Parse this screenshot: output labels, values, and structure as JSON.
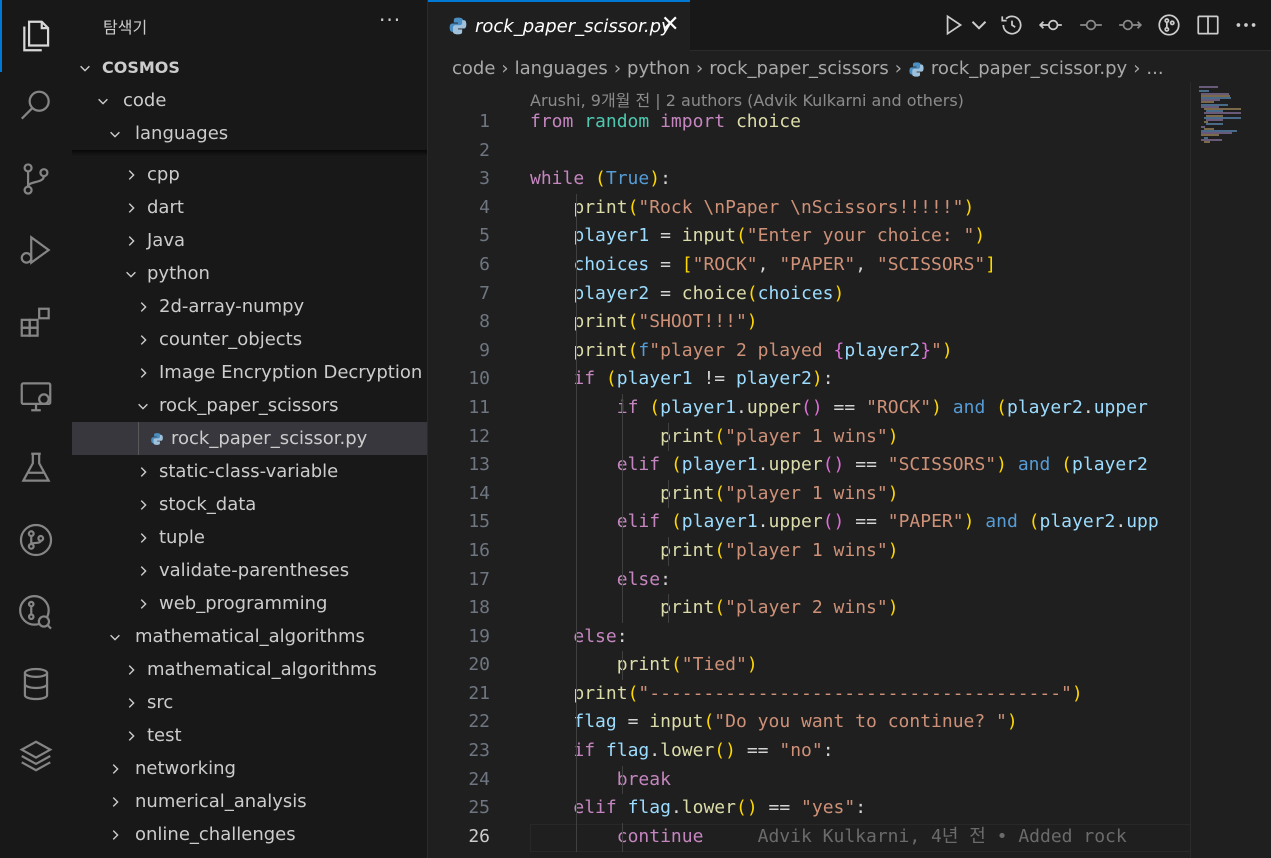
{
  "sidebar": {
    "title": "탐색기",
    "more": "···",
    "tree": [
      {
        "label": "COSMOS",
        "depth": 0,
        "expanded": true,
        "root": true
      },
      {
        "label": "code",
        "depth": 1,
        "expanded": true
      },
      {
        "label": "languages",
        "depth": 2,
        "expanded": true
      },
      {
        "label": "cpp",
        "depth": 3,
        "expanded": false
      },
      {
        "label": "dart",
        "depth": 3,
        "expanded": false
      },
      {
        "label": "Java",
        "depth": 3,
        "expanded": false
      },
      {
        "label": "python",
        "depth": 3,
        "expanded": true
      },
      {
        "label": "2d-array-numpy",
        "depth": 4,
        "expanded": false
      },
      {
        "label": "counter_objects",
        "depth": 4,
        "expanded": false
      },
      {
        "label": "Image Encryption Decryption",
        "depth": 4,
        "expanded": false
      },
      {
        "label": "rock_paper_scissors",
        "depth": 4,
        "expanded": true
      },
      {
        "label": "rock_paper_scissor.py",
        "depth": 5,
        "file": true,
        "selected": true
      },
      {
        "label": "static-class-variable",
        "depth": 4,
        "expanded": false
      },
      {
        "label": "stock_data",
        "depth": 4,
        "expanded": false
      },
      {
        "label": "tuple",
        "depth": 4,
        "expanded": false
      },
      {
        "label": "validate-parentheses",
        "depth": 4,
        "expanded": false
      },
      {
        "label": "web_programming",
        "depth": 4,
        "expanded": false
      },
      {
        "label": "mathematical_algorithms",
        "depth": 2,
        "expanded": true
      },
      {
        "label": "mathematical_algorithms",
        "depth": 3,
        "expanded": false
      },
      {
        "label": "src",
        "depth": 3,
        "expanded": false
      },
      {
        "label": "test",
        "depth": 3,
        "expanded": false
      },
      {
        "label": "networking",
        "depth": 2,
        "expanded": false
      },
      {
        "label": "numerical_analysis",
        "depth": 2,
        "expanded": false
      },
      {
        "label": "online_challenges",
        "depth": 2,
        "expanded": false
      }
    ]
  },
  "activity_icons": [
    "files-icon",
    "search-icon",
    "source-control-icon",
    "run-debug-icon",
    "extensions-icon",
    "remote-explorer-icon",
    "testing-icon",
    "git-graph-icon",
    "pull-requests-icon",
    "database-icon",
    "layers-icon"
  ],
  "editor": {
    "tab_label": "rock_paper_scissor.py",
    "close": "✕",
    "breadcrumb": [
      "code",
      "languages",
      "python",
      "rock_paper_scissors",
      "rock_paper_scissor.py",
      "..."
    ],
    "blame_header": "Arushi, 9개월 전 | 2 authors (Advik Kulkarni and others)",
    "inline_blame": "Advik Kulkarni, 4년 전 • Added rock",
    "current_line": 26,
    "line_numbers": [
      "1",
      "2",
      "3",
      "4",
      "5",
      "6",
      "7",
      "8",
      "9",
      "10",
      "11",
      "12",
      "13",
      "14",
      "15",
      "16",
      "17",
      "18",
      "19",
      "20",
      "21",
      "22",
      "23",
      "24",
      "25",
      "26"
    ],
    "lines": [
      "from random import choice",
      "",
      "while (True):",
      "    print(\"Rock \\nPaper \\nScissors!!!!!\")",
      "    player1 = input(\"Enter your choice: \")",
      "    choices = [\"ROCK\", \"PAPER\", \"SCISSORS\"]",
      "    player2 = choice(choices)",
      "    print(\"SHOOT!!!\")",
      "    print(f\"player 2 played {player2}\")",
      "    if (player1 != player2):",
      "        if (player1.upper() == \"ROCK\") and (player2.upper",
      "            print(\"player 1 wins\")",
      "        elif (player1.upper() == \"SCISSORS\") and (player2",
      "            print(\"player 1 wins\")",
      "        elif (player1.upper() == \"PAPER\") and (player2.upp",
      "            print(\"player 1 wins\")",
      "        else:",
      "            print(\"player 2 wins\")",
      "    else:",
      "        print(\"Tied\")",
      "    print(\"--------------------------------------\")",
      "    flag = input(\"Do you want to continue? \")",
      "    if flag.lower() == \"no\":",
      "        break",
      "    elif flag.lower() == \"yes\":",
      "        continue"
    ]
  },
  "colors": {
    "accent": "#0078d4",
    "keyword": "#c586c0",
    "string": "#ce9178",
    "function": "#dcdcaa",
    "variable": "#9cdcfe"
  }
}
